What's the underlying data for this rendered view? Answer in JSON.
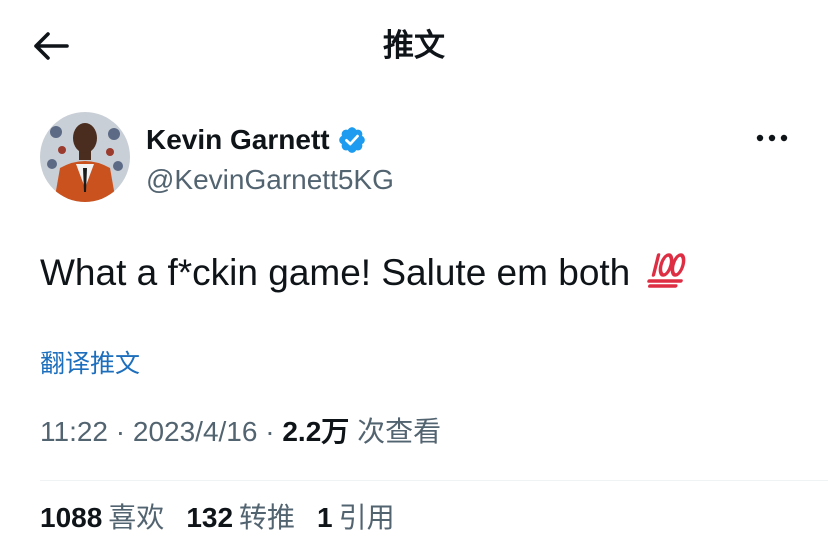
{
  "header": {
    "title": "推文",
    "back_icon": "arrow-left-icon"
  },
  "author": {
    "display_name": "Kevin Garnett",
    "handle": "@KevinGarnett5KG",
    "verified_icon": "verified-badge-icon",
    "more_icon": "more-horizontal-icon"
  },
  "tweet": {
    "text": "What a f*ckin game! Salute em both",
    "emoji": "hundred-points-emoji"
  },
  "translate": {
    "label": "翻译推文"
  },
  "meta": {
    "time": "11:22",
    "sep1": " · ",
    "date": "2023/4/16",
    "sep2": " · ",
    "views_count": "2.2万",
    "views_label": "次查看"
  },
  "stats": {
    "likes_count": "1088",
    "likes_label": "喜欢",
    "retweets_count": "132",
    "retweets_label": "转推",
    "quotes_count": "1",
    "quotes_label": "引用"
  },
  "colors": {
    "text": "#0f1419",
    "secondary": "#536471",
    "link": "#1d6fbd",
    "verified": "#1d9bf0",
    "emoji": "#dd2e44"
  }
}
